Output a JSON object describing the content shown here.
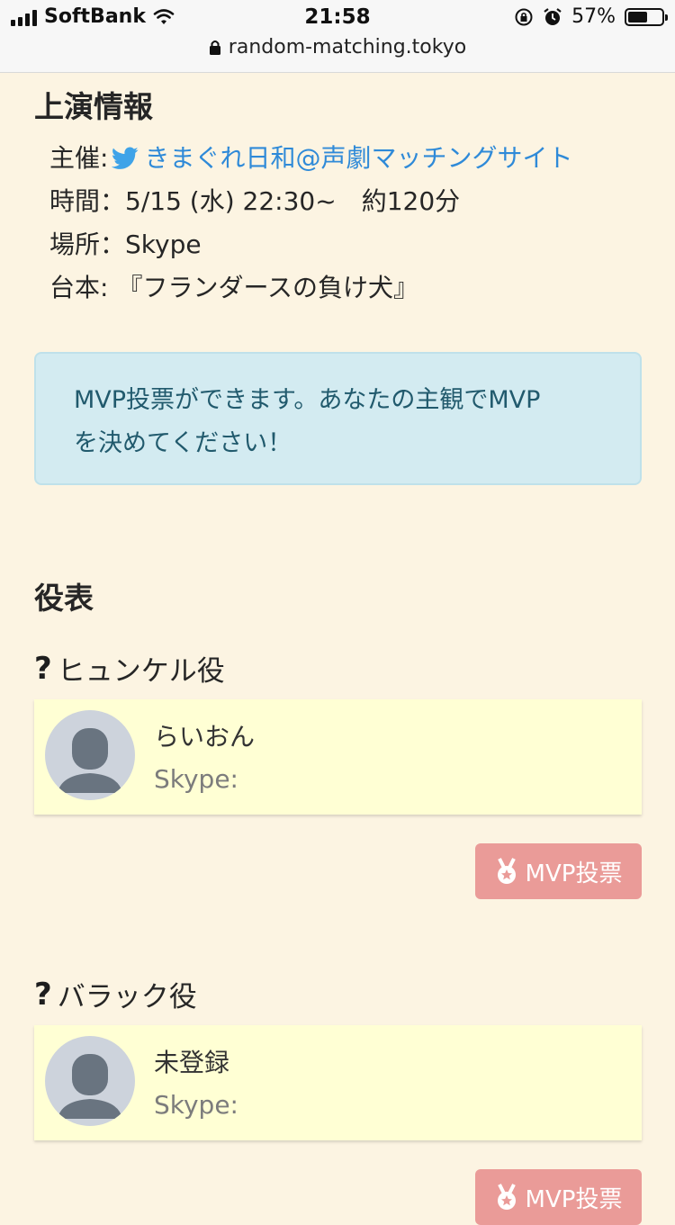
{
  "status_bar": {
    "carrier": "SoftBank",
    "time": "21:58",
    "battery": "57%",
    "battery_level": 0.57
  },
  "url_bar": {
    "url": "random-matching.tokyo"
  },
  "performance": {
    "title": "上演情報",
    "host_label": "主催:",
    "host_name": "きまぐれ日和@声劇マッチングサイト",
    "time_label": "時間：",
    "time_value": "5/15 (水) 22:30~　約120分",
    "place_label": "場所：",
    "place_value": "Skype",
    "script_label": "台本:",
    "script_value": "『フランダースの負け犬』"
  },
  "notice": {
    "line1": "MVP投票ができます。あなたの主観でMVP",
    "line2": "を決めてください！"
  },
  "cast": {
    "title": "役表",
    "roles": [
      {
        "role": "ヒュンケル役",
        "name": "らいおん",
        "skype": "Skype:",
        "vote_label": "MVP投票"
      },
      {
        "role": "バラック役",
        "name": "未登録",
        "skype": "Skype:",
        "vote_label": "MVP投票"
      }
    ]
  },
  "colors": {
    "page_bg": "#fcf4e2",
    "link": "#2f8ad8",
    "alert_bg": "#d3ebf1",
    "card_bg": "#ffffd4",
    "vote_button": "#ea9b98"
  },
  "icons": [
    "signal-icon",
    "wifi-icon",
    "orientation-lock-icon",
    "alarm-icon",
    "battery-icon",
    "lock-icon",
    "twitter-bird-icon",
    "question-icon",
    "avatar-icon",
    "medal-icon"
  ]
}
